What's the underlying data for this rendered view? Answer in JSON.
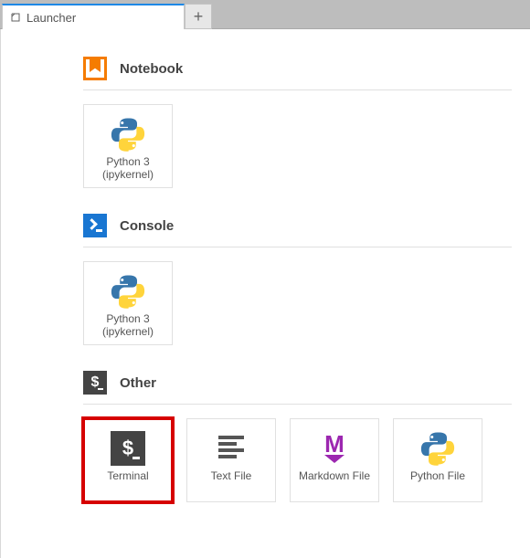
{
  "tab": {
    "title": "Launcher"
  },
  "sections": {
    "notebook": {
      "title": "Notebook",
      "cards": [
        {
          "label": "Python 3",
          "sub": "(ipykernel)"
        }
      ]
    },
    "console": {
      "title": "Console",
      "cards": [
        {
          "label": "Python 3",
          "sub": "(ipykernel)"
        }
      ]
    },
    "other": {
      "title": "Other",
      "icon_text": "$",
      "cards": [
        {
          "label": "Terminal",
          "highlight": true
        },
        {
          "label": "Text File"
        },
        {
          "label": "Markdown File"
        },
        {
          "label": "Python File"
        }
      ]
    }
  }
}
